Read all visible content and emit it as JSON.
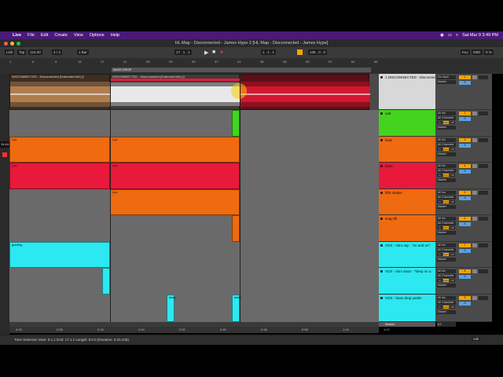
{
  "menubar": {
    "apple": "",
    "items": [
      "Live",
      "File",
      "Edit",
      "Create",
      "View",
      "Options",
      "Help"
    ],
    "clock": "Sat Mar 9  3:49 PM"
  },
  "window": {
    "title": "HL Map - Disconnected - James Hype 2  [HL Map - Disconnected - James Hype]"
  },
  "transport": {
    "link": "Link",
    "tap": "Tap",
    "tempo": "124.00",
    "sig": "4 / 4",
    "bar": "1 Bar",
    "position": "17 . 1 . 1",
    "loop_start": "1 . 1 . 1",
    "loop_len": "136 . 0 . 0",
    "key": "Key",
    "midi": "MIDI",
    "cpu": "9 %"
  },
  "ruler": {
    "locator": "BASS DROP",
    "bars": [
      "1",
      "5",
      "9",
      "13",
      "17",
      "21",
      "25",
      "29",
      "33",
      "37",
      "41",
      "45",
      "49",
      "53",
      "57",
      "61",
      "65"
    ],
    "time_labels": [
      "0:00",
      "0:08",
      "0:16",
      "0:24",
      "0:32",
      "0:40",
      "0:48",
      "0:56",
      "1:04",
      "1:12"
    ]
  },
  "side_timer": "11:14",
  "tracks": [
    {
      "name": "1 DISCONNECTED - Disconnected (Ext...",
      "color": "#d8d8d8",
      "input": "No Input",
      "output": "Master",
      "num": "1"
    },
    {
      "name": "edit",
      "color": "#44d31f",
      "input": "All Ins",
      "output": "Master",
      "num": "2"
    },
    {
      "name": "beat",
      "color": "#f06a10",
      "input": "All Ins",
      "output": "Master",
      "num": "3"
    },
    {
      "name": "bass",
      "color": "#e8193a",
      "input": "All Ins",
      "output": "Master",
      "num": "4"
    },
    {
      "name": "fifth shaker",
      "color": "#f06a10",
      "input": "All Ins",
      "output": "Master",
      "num": "5"
    },
    {
      "name": "snap fill",
      "color": "#f06a10",
      "input": "All Ins",
      "output": "Master",
      "num": "6"
    },
    {
      "name": "VOX - intro rap - \"on and on\"",
      "color": "#2ce8f0",
      "input": "All Ins",
      "output": "Master",
      "num": "7"
    },
    {
      "name": "VOX - intro bass - \"keep on a",
      "color": "#2ce8f0",
      "input": "All Ins",
      "output": "Master",
      "num": "8"
    },
    {
      "name": "VOX - bass drop yeahs",
      "color": "#2ce8f0",
      "input": "All Ins",
      "output": "Master",
      "num": "9"
    }
  ],
  "io_labels": {
    "channel": "All Channels",
    "monitor": [
      "In",
      "Auto",
      "Off"
    ]
  },
  "clips": {
    "audio_top": "DISCONNECTED - Disconnected (Extended Mix) [1",
    "audio_mid": "DISCONNECTED - Disconnected (Extended Mix) [1",
    "beat1": "Lyd",
    "beat2": "Lyd",
    "bass1": "Lyd",
    "bass2": "Lyd",
    "shaker": "Lyd",
    "vox1": "guiding",
    "vox3a": "keep",
    "vox3b": "keep"
  },
  "master": {
    "name": "Master",
    "sel": "1/2"
  },
  "status": {
    "selection": "Time Selection   Start: 9.1.1   End: 17.1.1   Length: 8.0.0  (Duration: 0:15.236)",
    "edit": "edit"
  },
  "colors": {
    "menubar": "#4a1a78",
    "orange": "#f06a10",
    "red": "#e8193a",
    "green": "#44d31f",
    "cyan": "#2ce8f0",
    "yellow": "#f5d000"
  }
}
